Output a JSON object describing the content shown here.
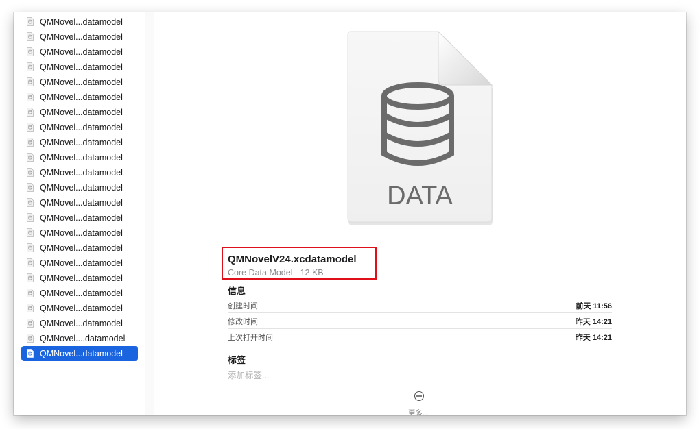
{
  "sidebar": {
    "items": [
      {
        "label": "QMNovel...datamodel"
      },
      {
        "label": "QMNovel...datamodel"
      },
      {
        "label": "QMNovel...datamodel"
      },
      {
        "label": "QMNovel...datamodel"
      },
      {
        "label": "QMNovel...datamodel"
      },
      {
        "label": "QMNovel...datamodel"
      },
      {
        "label": "QMNovel...datamodel"
      },
      {
        "label": "QMNovel...datamodel"
      },
      {
        "label": "QMNovel...datamodel"
      },
      {
        "label": "QMNovel...datamodel"
      },
      {
        "label": "QMNovel...datamodel"
      },
      {
        "label": "QMNovel...datamodel"
      },
      {
        "label": "QMNovel...datamodel"
      },
      {
        "label": "QMNovel...datamodel"
      },
      {
        "label": "QMNovel...datamodel"
      },
      {
        "label": "QMNovel...datamodel"
      },
      {
        "label": "QMNovel...datamodel"
      },
      {
        "label": "QMNovel...datamodel"
      },
      {
        "label": "QMNovel...datamodel"
      },
      {
        "label": "QMNovel...datamodel"
      },
      {
        "label": "QMNovel...datamodel"
      },
      {
        "label": "QMNovel....datamodel"
      },
      {
        "label": "QMNovel...datamodel",
        "selected": true
      }
    ]
  },
  "preview": {
    "icon_text": "DATA",
    "file_name": "QMNovelV24.xcdatamodel",
    "file_kind": "Core Data Model - 12 KB",
    "info_heading": "信息",
    "info": [
      {
        "key": "创建时间",
        "value": "前天 11:56"
      },
      {
        "key": "修改时间",
        "value": "昨天 14:21"
      },
      {
        "key": "上次打开时间",
        "value": "昨天 14:21"
      }
    ],
    "tags_heading": "标签",
    "tags_placeholder": "添加标签...",
    "more_label": "更多..."
  },
  "colors": {
    "selection": "#1a64e0",
    "highlight_border": "#e0101a"
  }
}
